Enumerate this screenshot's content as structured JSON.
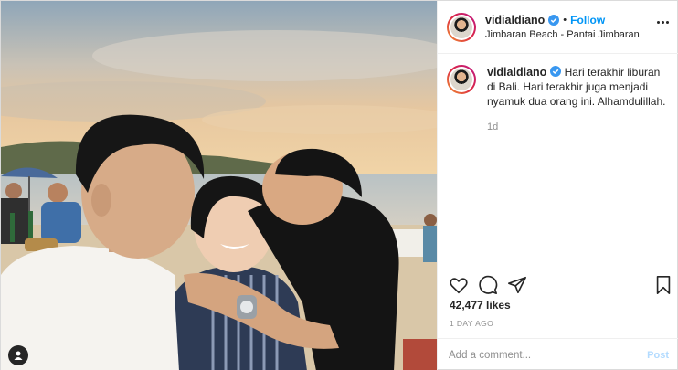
{
  "post": {
    "username": "vidialdiano",
    "follow_label": "Follow",
    "separator": "•",
    "location": "Jimbaran Beach - Pantai Jimbaran",
    "caption": {
      "username": "vidialdiano",
      "text": "Hari terakhir liburan di Bali. Hari terakhir juga menjadi nyamuk dua orang ini. Alhamdulillah.",
      "time": "1d"
    },
    "likes": "42,477 likes",
    "age": "1 DAY AGO",
    "comment": {
      "placeholder": "Add a comment...",
      "post_label": "Post"
    }
  },
  "icons": {
    "more": "more-options-icon",
    "verified": "verified-badge-icon",
    "like": "heart-icon",
    "comment": "comment-bubble-icon",
    "share": "paper-plane-icon",
    "save": "bookmark-icon",
    "tag": "user-tag-icon"
  },
  "colors": {
    "link_blue": "#0095f6",
    "post_disabled": "#b3dbff",
    "muted_gray": "#8e8e8e",
    "border": "#dbdbdb"
  }
}
